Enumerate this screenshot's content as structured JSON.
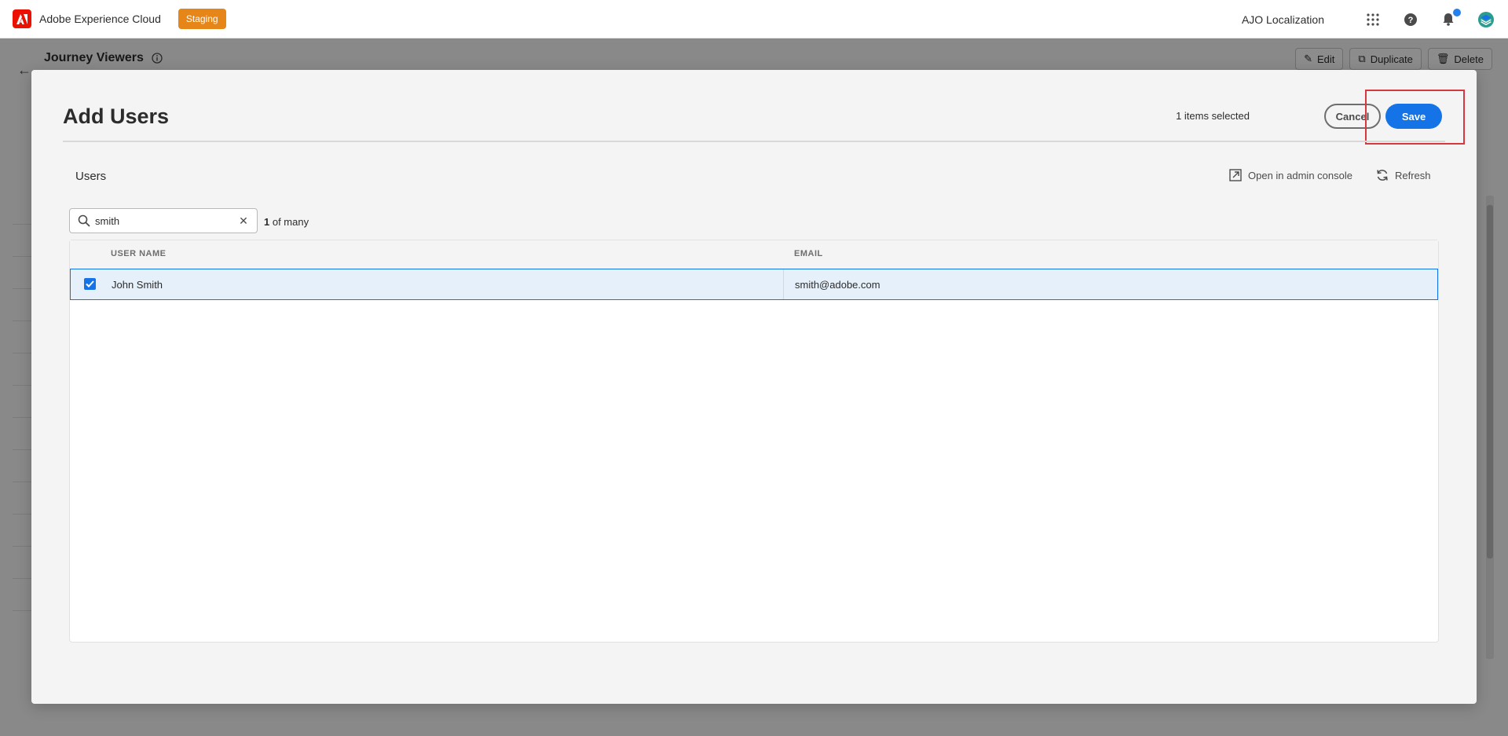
{
  "shell": {
    "brand": "Adobe Experience Cloud",
    "environment_badge": "Staging",
    "org_name": "AJO Localization",
    "accent_color": "#eb1000"
  },
  "background_page": {
    "title": "Journey Viewers",
    "actions": [
      "Edit",
      "Duplicate",
      "Delete"
    ]
  },
  "modal": {
    "title": "Add Users",
    "selected_text": "1 items selected",
    "cancel_label": "Cancel",
    "save_label": "Save",
    "section_label": "Users",
    "open_admin_label": "Open in admin console",
    "refresh_label": "Refresh",
    "search": {
      "value": "smith",
      "count_number": "1",
      "count_suffix": " of many"
    },
    "table": {
      "columns": [
        "USER NAME",
        "EMAIL"
      ],
      "rows": [
        {
          "selected": true,
          "user_name": "John Smith",
          "email": "smith@adobe.com"
        }
      ]
    },
    "primary_color": "#1473e6"
  }
}
